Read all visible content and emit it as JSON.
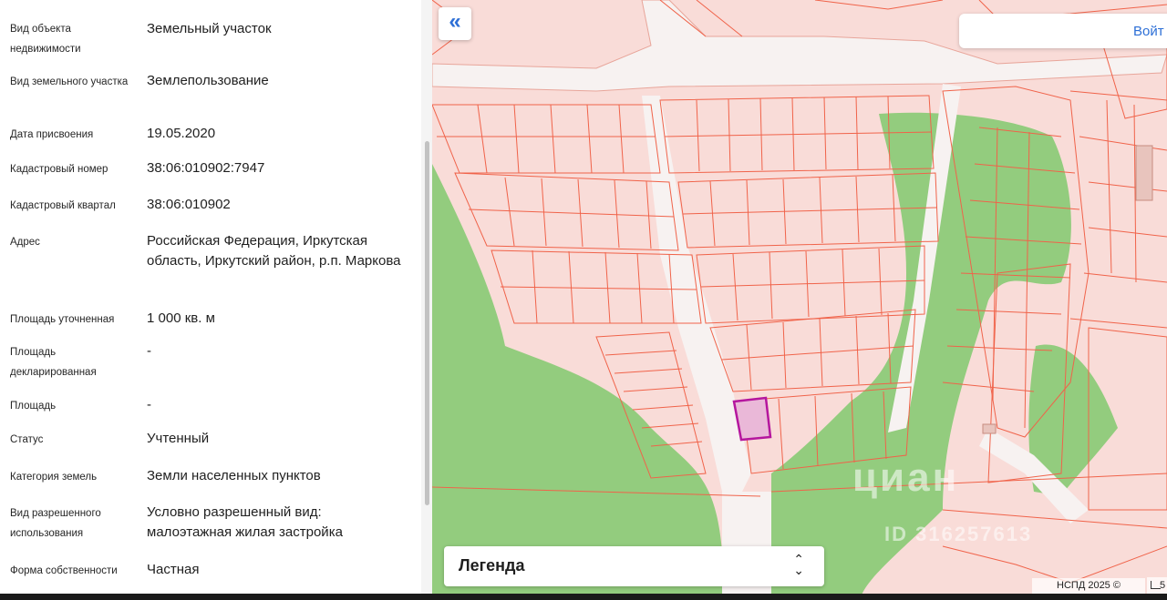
{
  "details": [
    {
      "label": "Вид объекта недвижимости",
      "value": "Земельный участок"
    },
    {
      "label": "Вид земельного участка",
      "value": "Землепользование"
    },
    {
      "label": "Дата присвоения",
      "value": "19.05.2020"
    },
    {
      "label": "Кадастровый номер",
      "value": "38:06:010902:7947"
    },
    {
      "label": "Кадастровый квартал",
      "value": "38:06:010902"
    },
    {
      "label": "Адрес",
      "value": "Российская Федерация, Иркутская область, Иркутский район, р.п. Маркова"
    },
    {
      "label": "Площадь уточненная",
      "value": "1 000 кв. м"
    },
    {
      "label": "Площадь декларированная",
      "value": "-"
    },
    {
      "label": "Площадь",
      "value": "-"
    },
    {
      "label": "Статус",
      "value": "Учтенный"
    },
    {
      "label": "Категория земель",
      "value": "Земли населенных пунктов"
    },
    {
      "label": "Вид разрешенного использования",
      "value": "Условно разрешенный вид: малоэтажная жилая застройка"
    },
    {
      "label": "Форма собственности",
      "value": "Частная"
    }
  ],
  "map": {
    "collapse_icon": "double-chevron-left-icon",
    "collapse_label": "«",
    "login_label": "Войт",
    "legend_title": "Легенда",
    "legend_icon": "chevron-updown-icon",
    "legend_arrows": "⌃⌄",
    "copyright": "НСПД 2025 ©",
    "scale_label": "5",
    "watermark": "циан",
    "watermark_id": "ID 316257613",
    "colors": {
      "parcel_fill": "#f9dcd8",
      "parcel_line": "#f0634a",
      "forest": "#93cc7e",
      "road": "#f7f2f1",
      "selected_fill": "#eab8d8",
      "selected_line": "#b5169e"
    }
  }
}
